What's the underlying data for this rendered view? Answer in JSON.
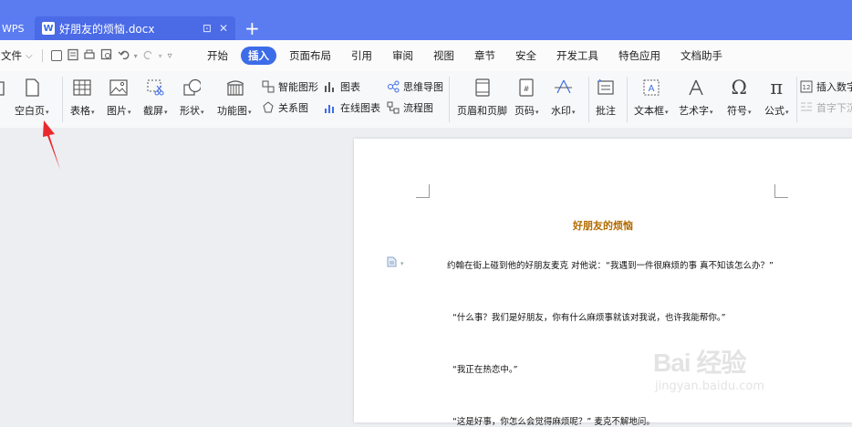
{
  "titlebar": {
    "app_tab": "WPS",
    "doc_tab": {
      "icon_letter": "W",
      "title": "好朋友的烦恼.docx",
      "restore_glyph": "⊡",
      "close_glyph": "✕"
    },
    "new_tab": "+"
  },
  "menubar": {
    "file_label": "文件",
    "file_caret": "⌵",
    "tabs": [
      "开始",
      "插入",
      "页面布局",
      "引用",
      "审阅",
      "视图",
      "章节",
      "安全",
      "开发工具",
      "特色应用",
      "文档助手"
    ],
    "active_tab": "插入"
  },
  "ribbon": {
    "blank_page": "空白页",
    "table": "表格",
    "picture": "图片",
    "screenshot": "截屏",
    "shape": "形状",
    "function_chart": "功能图",
    "smart_graphic": "智能图形",
    "chart": "图表",
    "mind_map": "思维导图",
    "relation_chart": "关系图",
    "online_chart": "在线图表",
    "flowchart": "流程图",
    "header_footer": "页眉和页脚",
    "page_number": "页码",
    "watermark": "水印",
    "comment": "批注",
    "text_box": "文本框",
    "word_art": "艺术字",
    "symbol": "符号",
    "formula": "公式",
    "insert_number": "插入数字",
    "drop_cap": "首字下沉",
    "caret": "▾"
  },
  "document": {
    "title": "好朋友的烦恼",
    "paragraphs": [
      "约翰在街上碰到他的好朋友麦克 对他说：“我遇到一件很麻烦的事 真不知该怎么办？”",
      "“什么事？我们是好朋友，你有什么麻烦事就该对我说，也许我能帮你。”",
      "“我正在热恋中。”",
      "“这是好事，你怎么会觉得麻烦呢？” 麦克不解地问。"
    ]
  },
  "watermark": {
    "brand": "Bai 经验",
    "url": "jingyan.baidu.com"
  },
  "colors": {
    "titlebar": "#5b7cf1",
    "accent": "#3d6ce8",
    "doc_title": "#b36b00",
    "arrow": "#e8292d"
  }
}
